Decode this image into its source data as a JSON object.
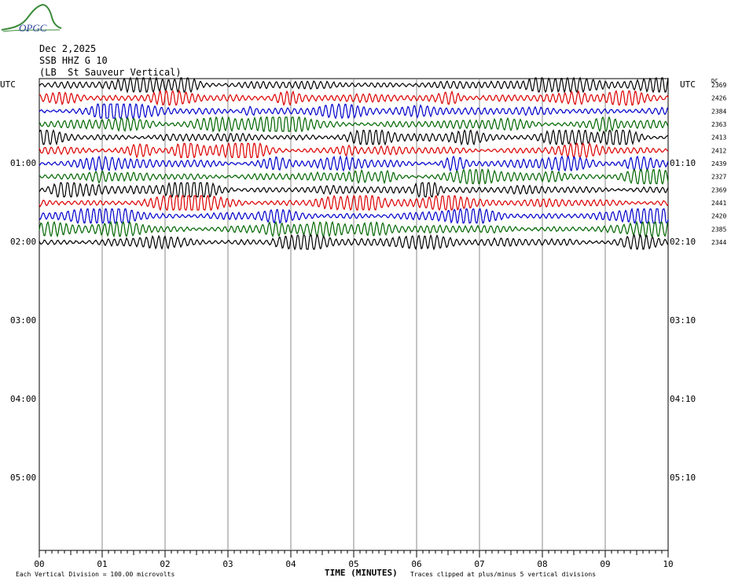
{
  "header": {
    "logo_text": "OPGC",
    "date": "Dec 2,2025",
    "station": "SSB HHZ G 10",
    "site": "(LB  St Sauveur Vertical)"
  },
  "chart_data": {
    "type": "line",
    "title": "",
    "xlabel": "TIME (MINUTES)",
    "x_ticks": [
      "00",
      "01",
      "02",
      "03",
      "04",
      "05",
      "06",
      "07",
      "08",
      "09",
      "10"
    ],
    "xlim": [
      0,
      10
    ],
    "left_axis_label": "UTC",
    "right_axis_label": "UTC",
    "dc_label": "DC",
    "left_time_labels": [
      "01:00",
      "02:00",
      "03:00",
      "04:00",
      "05:00"
    ],
    "right_time_labels": [
      "01:10",
      "02:10",
      "03:10",
      "04:10",
      "05:10"
    ],
    "trace_colors": [
      "#000000",
      "#dd0000",
      "#0000cc",
      "#006600"
    ],
    "dc_offsets": [
      2369,
      2426,
      2384,
      2363,
      2413,
      2412,
      2439,
      2327,
      2369,
      2441,
      2420,
      2385,
      2344
    ],
    "grid": true,
    "footer_left": "Each Vertical Division =  100.00 microvolts",
    "footer_right": "Traces clipped at plus/minus 5 vertical divisions"
  }
}
